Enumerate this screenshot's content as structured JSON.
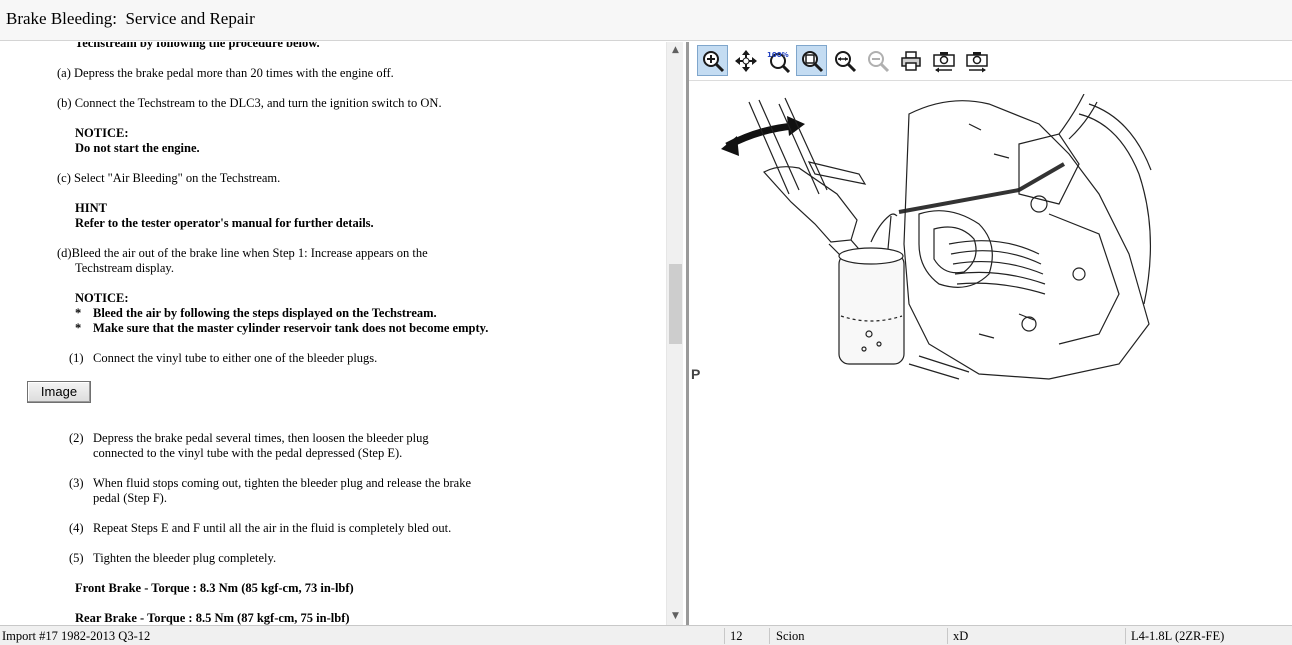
{
  "window": {
    "title": "Brake Bleeding:  Service and Repair"
  },
  "procedure": {
    "cut_top": "Techstream by following the procedure below.",
    "steps": [
      {
        "prefix": "(a)",
        "text": "Depress the brake pedal more than 20 times with the engine off."
      },
      {
        "prefix": "(b)",
        "text": "Connect the Techstream to the DLC3, and turn the ignition switch to ON."
      },
      {
        "prefix": "(c)",
        "text": "Select \"Air Bleeding\" on the Techstream."
      },
      {
        "prefix": "(d)",
        "text_line1": "Bleed the air out of the brake line when Step 1: Increase appears on the",
        "text_line2": "Techstream display."
      }
    ],
    "notice1": {
      "label": "NOTICE:",
      "text": "Do not start the engine."
    },
    "hint": {
      "label": "HINT",
      "text": "Refer to the tester operator's manual for further details."
    },
    "notice2": {
      "label": "NOTICE:",
      "bullets": [
        {
          "mark": "*",
          "text": "Bleed the air by following the steps displayed on the Techstream."
        },
        {
          "mark": "*",
          "text": "Make sure that the master cylinder reservoir tank does not become empty."
        }
      ]
    },
    "substeps": [
      {
        "prefix": "(1)",
        "lines": [
          "Connect the vinyl tube to either one of the bleeder plugs."
        ]
      },
      {
        "prefix": "(2)",
        "lines": [
          "Depress the brake pedal several times, then loosen the bleeder plug",
          "connected to the vinyl tube with the pedal depressed (Step E)."
        ]
      },
      {
        "prefix": "(3)",
        "lines": [
          "When fluid stops coming out, tighten the bleeder plug and release the brake",
          "pedal (Step F)."
        ]
      },
      {
        "prefix": "(4)",
        "lines": [
          "Repeat Steps E and F until all the air in the fluid is completely bled out."
        ]
      },
      {
        "prefix": "(5)",
        "lines": [
          "Tighten the bleeder plug completely."
        ]
      }
    ],
    "image_button": "Image",
    "torque_front": "Front Brake - Torque : 8.3 Nm (85 kgf-cm, 73 in-lbf)",
    "torque_rear": "Rear Brake - Torque : 8.5 Nm (87 kgf-cm, 75 in-lbf)"
  },
  "scrollbar": {
    "up": "▲",
    "down": "▼"
  },
  "viewer": {
    "toolbar": [
      {
        "name": "zoom-in",
        "icon": "zoom-in-icon",
        "active": true
      },
      {
        "name": "pan",
        "icon": "pan-arrows-icon",
        "active": false
      },
      {
        "name": "zoom-100",
        "icon": "zoom-100-icon",
        "label": "100%",
        "active": false
      },
      {
        "name": "zoom-fit",
        "icon": "zoom-fit-icon",
        "active": true
      },
      {
        "name": "zoom-width",
        "icon": "zoom-width-icon",
        "active": false
      },
      {
        "name": "zoom-out",
        "icon": "zoom-out-icon",
        "active": false
      },
      {
        "name": "print",
        "icon": "printer-icon",
        "active": false
      },
      {
        "name": "prev-image",
        "icon": "camera-prev-icon",
        "active": false
      },
      {
        "name": "next-image",
        "icon": "camera-next-icon",
        "active": false
      }
    ],
    "corner_mark": "P"
  },
  "status": {
    "import": "Import #17 1982-2013 Q3-12",
    "year": "12",
    "make": "Scion",
    "model": "xD",
    "engine": "L4-1.8L (2ZR-FE)"
  },
  "colors": {
    "active_tool": "#c4dcf2",
    "chrome": "#f0f0f0"
  }
}
